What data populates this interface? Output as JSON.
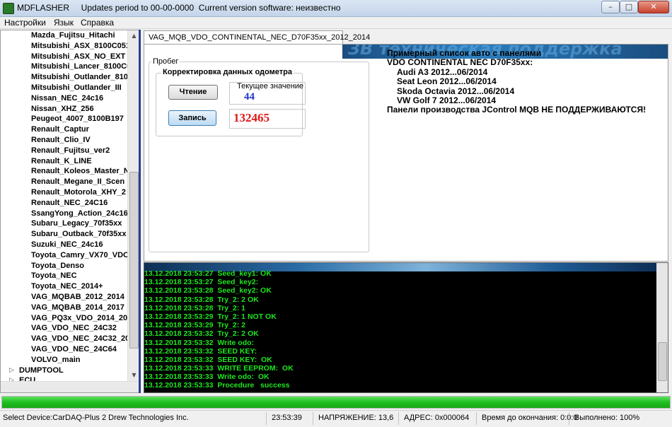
{
  "window": {
    "title": "MDFLASHER     Updates period to 00-00-0000  Current version software: неизвестно",
    "minimize_glyph": "–",
    "maximize_glyph": "□",
    "close_glyph": "✕"
  },
  "menu": [
    "Настройки",
    "Язык",
    "Справка"
  ],
  "tree": {
    "items": [
      "Mazda_Fujitsu_Hitachi",
      "Mitsubishi_ASX_8100C051",
      "Mitsubishi_ASX_NO_EXT",
      "Mitsubishi_Lancer_8100C0",
      "Mitsubishi_Outlander_810",
      "Mitsubishi_Outlander_III",
      "Nissan_NEC_24c16",
      "Nissan_XHZ_256",
      "Peugeot_4007_8100B197",
      "Renault_Captur",
      "Renault_Clio_IV",
      "Renault_Fujitsu_ver2",
      "Renault_K_LINE",
      "Renault_Koleos_Master_N",
      "Renault_Megane_II_Scen",
      "Renault_Motorola_XHY_2",
      "Renault_NEC_24C16",
      "SsangYong_Action_24c16",
      "Subaru_Legacy_70f35xx",
      "Subaru_Outback_70f35xx",
      "Suzuki_NEC_24c16",
      "Toyota_Camry_VX70_VDO",
      "Toyota_Denso",
      "Toyota_NEC",
      "Toyota_NEC_2014+",
      "VAG_MQBAB_2012_2014",
      "VAG_MQBAB_2014_2017",
      "VAG_PQ3x_VDO_2014_20",
      "VAG_VDO_NEC_24C32",
      "VAG_VDO_NEC_24C32_201",
      "VAG_VDO_NEC_24C64",
      "VOLVO_main"
    ],
    "groups": [
      "DUMPTOOL",
      "ECU"
    ]
  },
  "tab": {
    "label": "VAG_MQB_VDO_CONTINENTAL_NEC_D70F35xx_2012_2014",
    "banner_text": "ЗВ техническая поддержка"
  },
  "odometer": {
    "group_label": "Пробег",
    "subgroup_label": "Корректировка данных одометра",
    "read_button": "Чтение",
    "write_button": "Запись",
    "current_caption": "Текущее значение",
    "current_value": "44",
    "write_value": "132465"
  },
  "info": {
    "header": "Примерный список авто с панелями",
    "subheader": "VDO CONTINENTAL NEC D70F35xx:",
    "cars": [
      "Audi A3 2012...06/2014",
      "Seat Leon 2012...06/2014",
      "Skoda Octavia 2012...06/2014",
      "VW Golf 7 2012...06/2014"
    ],
    "note": "Панели производства JControl MQB НЕ ПОДДЕРЖИВАЮТСЯ!"
  },
  "log": [
    "13.12.2018 23:53:27  Seed_key1: OK",
    "13.12.2018 23:53:27  Seed_key2:",
    "13.12.2018 23:53:28  Seed_key2: OK",
    "13.12.2018 23:53:28  Try_2: 2 OK",
    "13.12.2018 23:53:28  Try_2: 1",
    "13.12.2018 23:53:29  Try_2: 1 NOT OK",
    "13.12.2018 23:53:29  Try_2: 2",
    "13.12.2018 23:53:32  Try_2: 2 OK",
    "13.12.2018 23:53:32  Write odo:",
    "13.12.2018 23:53:32  SEED KEY:",
    "13.12.2018 23:53:32  SEED KEY:  OK",
    "13.12.2018 23:53:33  WRITE EEPROM:  OK",
    "13.12.2018 23:53:33  Write odo:  OK",
    "13.12.2018 23:53:33  Procedure   success"
  ],
  "progress": {
    "value": 1.0,
    "color": "#1fbe1f"
  },
  "status": {
    "device": "Select Device:CarDAQ-Plus 2  Drew Technologies Inc.",
    "time": "23:53:39",
    "voltage": "НАПРЯЖЕНИЕ: 13,6",
    "address": "АДРЕС: 0x000064",
    "remaining": "Время до окончания: 0:0:0",
    "done": "Выполнено: 100%"
  },
  "colors": {
    "log_text": "#1ee61e",
    "current_value": "#2233cc",
    "write_value": "#e01818",
    "splitter": "#2c3e8c"
  }
}
